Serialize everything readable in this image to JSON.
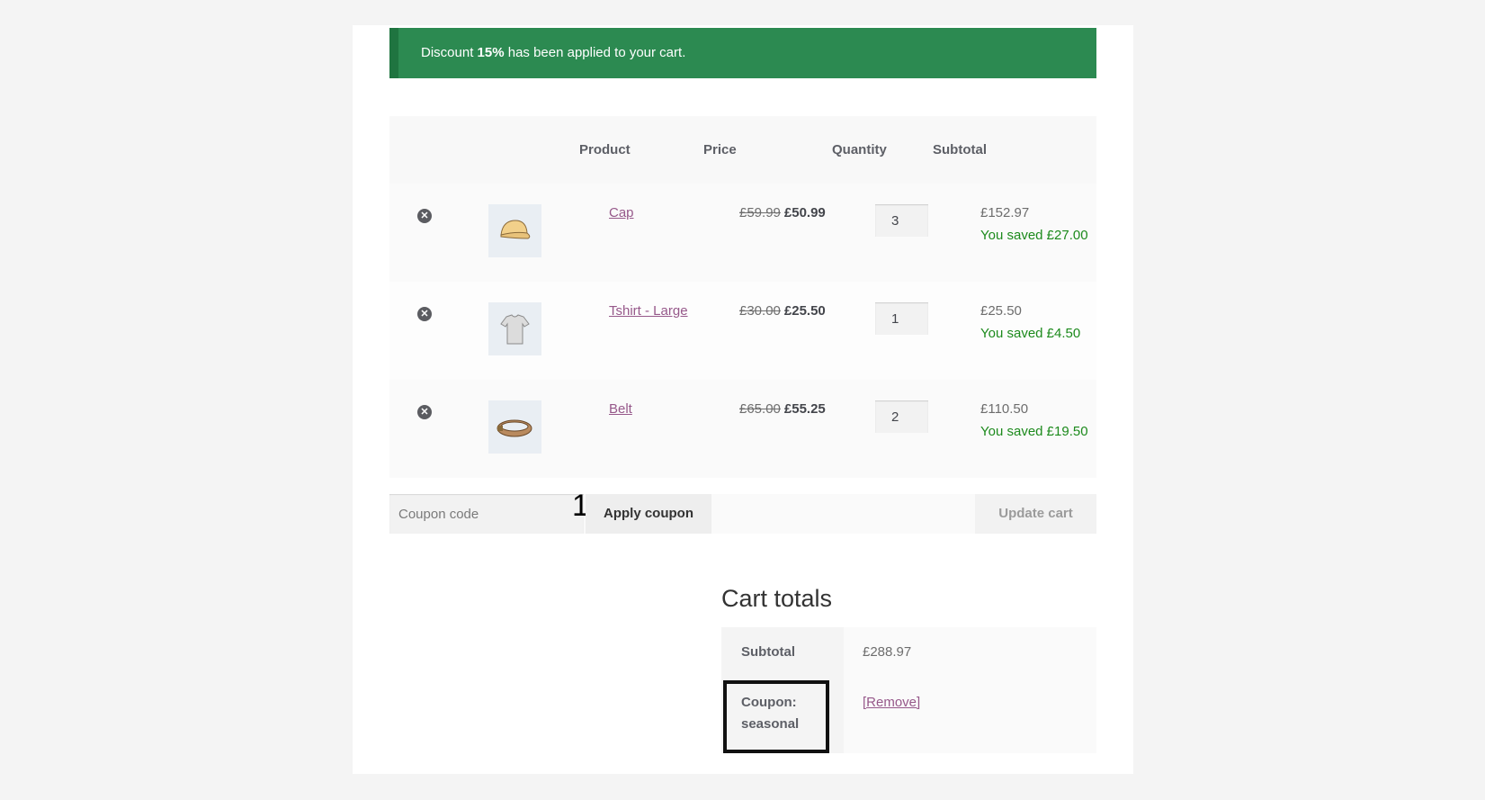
{
  "notice": {
    "prefix": "Discount ",
    "bold": "15%",
    "suffix": " has been applied to your cart."
  },
  "table": {
    "headers": {
      "product": "Product",
      "price": "Price",
      "quantity": "Quantity",
      "subtotal": "Subtotal"
    },
    "rows": [
      {
        "name": "Cap",
        "old_price": "£59.99",
        "new_price": "£50.99",
        "qty": "3",
        "subtotal": "£152.97",
        "saved": "You saved £27.00",
        "icon": "cap-icon"
      },
      {
        "name": "Tshirt - Large",
        "old_price": "£30.00",
        "new_price": "£25.50",
        "qty": "1",
        "subtotal": "£25.50",
        "saved": "You saved £4.50",
        "icon": "tshirt-icon"
      },
      {
        "name": "Belt",
        "old_price": "£65.00",
        "new_price": "£55.25",
        "qty": "2",
        "subtotal": "£110.50",
        "saved": "You saved £19.50",
        "icon": "belt-icon"
      }
    ]
  },
  "actions": {
    "coupon_placeholder": "Coupon code",
    "marker": "1",
    "apply_label": "Apply coupon",
    "update_label": "Update cart"
  },
  "totals": {
    "title": "Cart totals",
    "subtotal_label": "Subtotal",
    "subtotal_value": "£288.97",
    "coupon_label_1": "Coupon:",
    "coupon_label_2": "seasonal",
    "remove_label": "[Remove]"
  },
  "colors": {
    "notice_bg": "#2c8a51",
    "link": "#96588a",
    "saved": "#1c8a1c"
  }
}
